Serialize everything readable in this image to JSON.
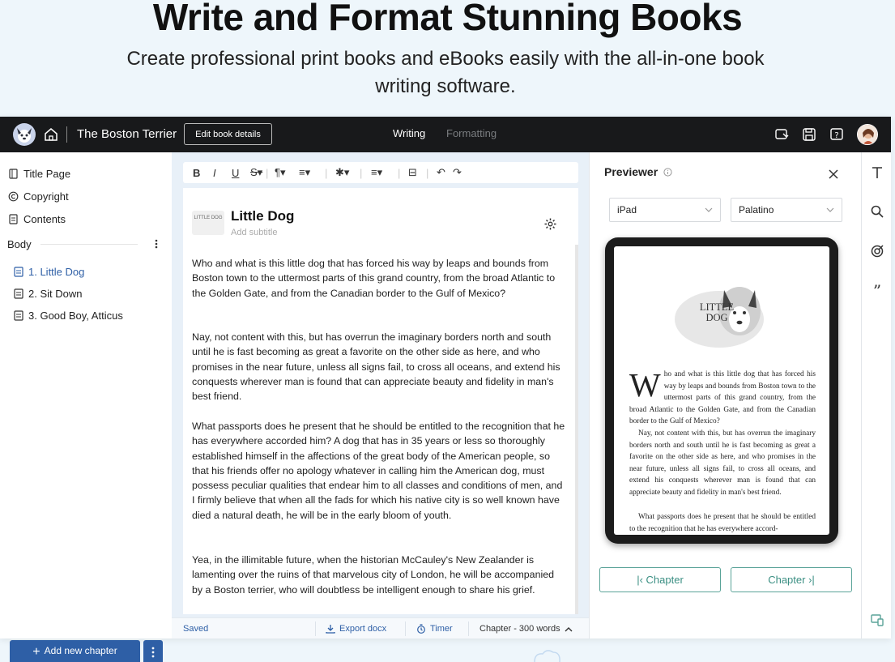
{
  "hero": {
    "title": "Write and Format Stunning Books",
    "subtitle": "Create professional print books and eBooks easily with the all-in-one book writing software."
  },
  "topbar": {
    "book_title": "The Boston Terrier",
    "edit_button": "Edit book details",
    "tabs": [
      {
        "label": "Writing",
        "active": true
      },
      {
        "label": "Formatting",
        "active": false
      }
    ],
    "icons": [
      "logo-icon",
      "home-icon",
      "preview-device-icon",
      "save-icon",
      "help-icon",
      "avatar"
    ]
  },
  "sidebar": {
    "front_matter": [
      {
        "label": "Title Page",
        "icon": "page-icon"
      },
      {
        "label": "Copyright",
        "icon": "copyright-icon"
      },
      {
        "label": "Contents",
        "icon": "contents-icon"
      }
    ],
    "section_label": "Body",
    "chapters": [
      {
        "label": "1. Little Dog",
        "active": true
      },
      {
        "label": "2. Sit Down",
        "active": false
      },
      {
        "label": "3. Good Boy, Atticus",
        "active": false
      }
    ],
    "add_chapter_button": "Add new chapter"
  },
  "editor": {
    "toolbar": [
      "bold-icon",
      "italic-icon",
      "underline-icon",
      "strikethrough-icon",
      "paragraph-icon",
      "align-icon",
      "ornament-icon",
      "list-icon",
      "scene-break-icon",
      "undo-icon",
      "redo-icon"
    ],
    "thumb_text": "LITTLE DOG",
    "chapter_title": "Little Dog",
    "subtitle_placeholder": "Add subtitle",
    "paragraphs": [
      "Who and what is this little dog that has forced his way by leaps and bounds from Boston town to the uttermost parts of this grand country, from the broad Atlantic to the Golden Gate, and from the Canadian border to the Gulf of Mexico?",
      "Nay, not content with this, but has overrun the imaginary borders north and south until he is fast becoming as great a favorite on the other side as here, and who promises in the near future, unless all signs fail, to cross all oceans, and extend his conquests wherever man is found that can appreciate beauty and fidelity in man's best friend.",
      "What passports does he present that he should be entitled to the recognition that he has everywhere accorded him? A dog that has in 35 years or less so thoroughly established himself in the affections of the great body of the American people, so that his friends offer no apology whatever in calling him the American dog, must possess peculiar qualities that endear him to all classes and conditions of men, and I firmly believe that when all the fads for which his native city is so well known have died a natural death, he will be in the early bloom of youth.",
      " Yea, in the illimitable future, when the historian McCauley's New Zealander is lamenting over the ruins of that marvelous city of London, he will be accompanied by a Boston terrier, who will doubtless be intelligent enough to share his grief."
    ],
    "status": {
      "saved": "Saved",
      "export": "Export docx",
      "timer": "Timer",
      "words": "Chapter - 300 words"
    }
  },
  "previewer": {
    "title": "Previewer",
    "device": "iPad",
    "font": "Palatino",
    "page_title_art": "LITTLE DOG",
    "page_paragraphs": [
      "ho and what is this little dog that has forced his way by leaps and bounds from Boston town to the uttermost parts of this grand country, from the broad Atlantic to the Golden Gate, and from the Canadian border to the Gulf of Mexico?",
      "Nay, not content with this, but has overrun the imaginary borders north and south until he is fast becoming as great a favorite on the other side as here, and who promises in the near future, unless all signs fail, to cross all oceans, and extend his conquests wherever man is found that can appreciate beauty and fidelity in man's best friend.",
      "What passports does he present that he should be entitled to the recognition that he has everywhere accord-"
    ],
    "dropcap": "W",
    "prev_button": "Chapter",
    "next_button": "Chapter"
  },
  "rightrail": {
    "icons": [
      "text-icon",
      "search-icon",
      "goal-icon",
      "quote-icon",
      "device-icon"
    ]
  },
  "colors": {
    "accent": "#2e5fa6",
    "topbar": "#18191b",
    "teal": "#3b8f83",
    "background": "#eef6fb"
  }
}
